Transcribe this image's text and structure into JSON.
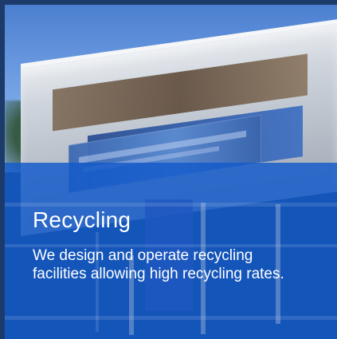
{
  "card": {
    "title": "Recycling",
    "description": "We design and operate recycling facilities allowing high recycling rates."
  },
  "colors": {
    "border": "#1d3b6a",
    "overlay": "#135aca",
    "text": "#ffffff"
  }
}
